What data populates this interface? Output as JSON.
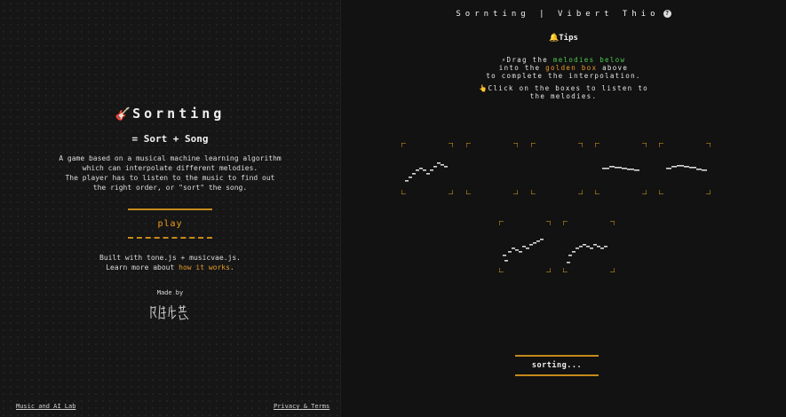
{
  "left": {
    "title": "Sornting",
    "title_icon": "guitar-icon",
    "subtitle": "= Sort + Song",
    "description": [
      "A game based on a musical machine learning algorithm",
      "which can interpolate different melodies.",
      "The player has to listen to the music to find out",
      "the right order, or \"sort\" the song."
    ],
    "play_label": "play",
    "built_with": "Built with tone.js + musicvae.js.",
    "learn_more_prefix": "Learn more about ",
    "learn_more_link": "how it works",
    "learn_more_suffix": ".",
    "made_by": "Made by",
    "footer_left": "Music and AI Lab",
    "footer_right": "Privacy & Terms"
  },
  "right": {
    "header_title": "Sornting",
    "header_sep": "|",
    "header_author": "Vibert Thio",
    "tips_icon": "tips-icon",
    "tips_title": "Tips",
    "tip1_prefix": "Drag the ",
    "tip1_green": "melodies below",
    "tip2_prefix": "into the ",
    "tip2_gold": "golden box",
    "tip2_suffix": " above",
    "tip3": "to complete the interpolation.",
    "tip4": "Click on the boxes to listen to",
    "tip5": "the melodies.",
    "sorting_label": "sorting...",
    "colors": {
      "accent": "#e69a2a",
      "highlight_green": "#4ec94e",
      "corner": "#c68a1a"
    }
  }
}
